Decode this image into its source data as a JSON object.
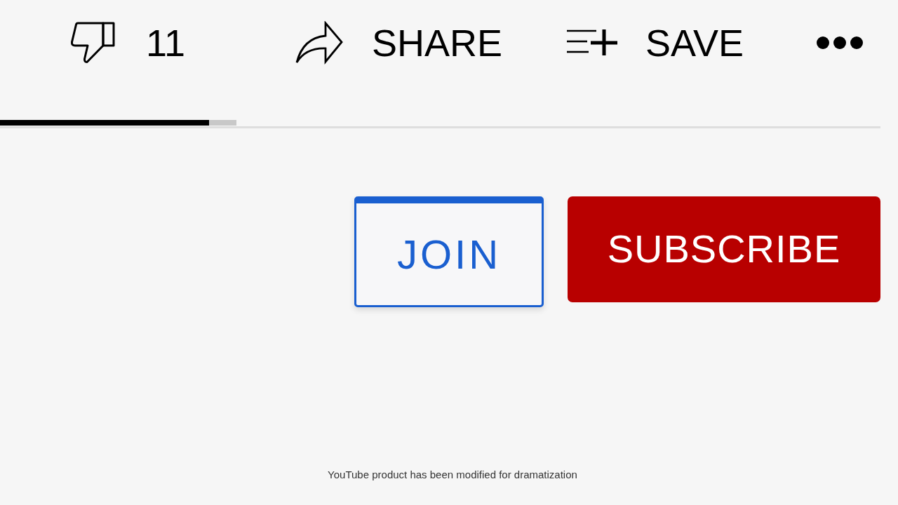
{
  "actions": [
    {
      "kind": "dislike",
      "label": "11"
    },
    {
      "kind": "share",
      "label": "SHARE"
    },
    {
      "kind": "save",
      "label": "SAVE"
    },
    {
      "kind": "more"
    }
  ],
  "progress": {
    "level": 0.2375
  },
  "buttons": [
    {
      "kind": "join",
      "label": "JOIN"
    },
    {
      "kind": "subscribe",
      "label": "SUBSCRIBE"
    }
  ],
  "disclaimer": "YouTube product has been modified for dramatization"
}
